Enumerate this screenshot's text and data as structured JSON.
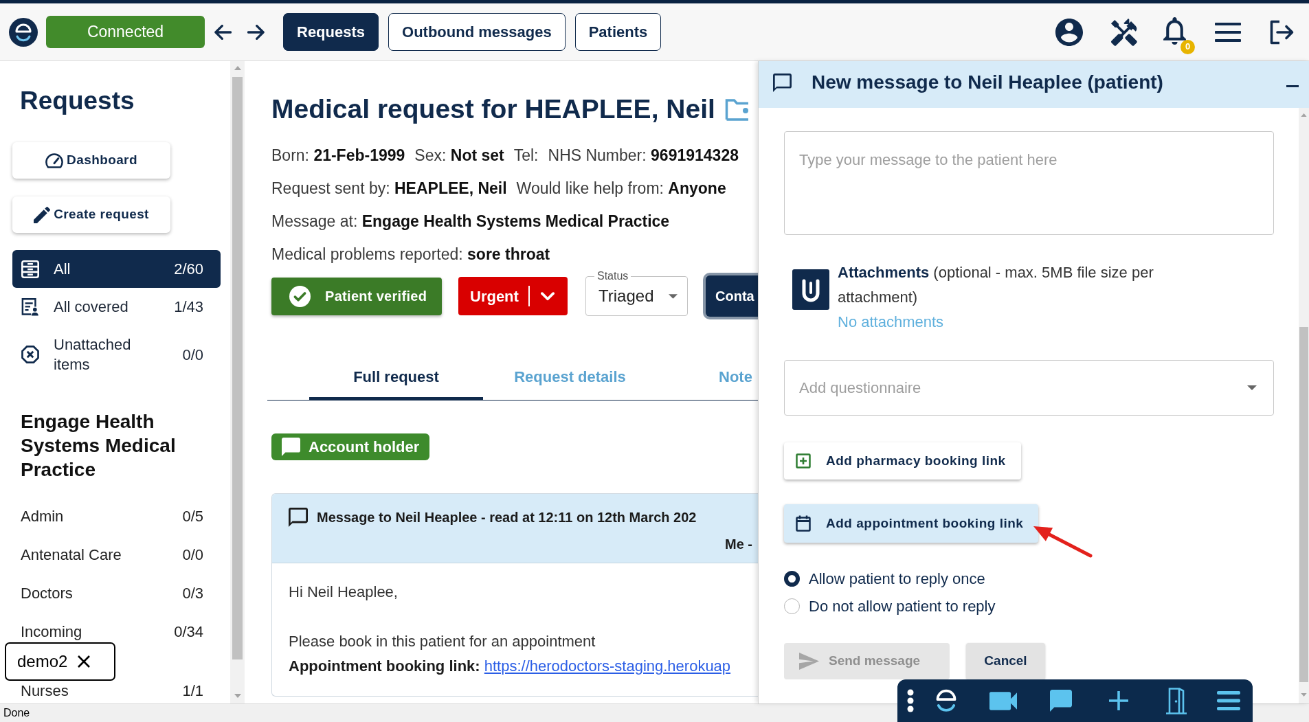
{
  "top_bar": {
    "connection": "Connected",
    "nav_tabs": [
      {
        "label": "Requests",
        "selected": true
      },
      {
        "label": "Outbound messages",
        "selected": false
      },
      {
        "label": "Patients",
        "selected": false
      }
    ],
    "notification_count": "0"
  },
  "sidebar": {
    "title": "Requests",
    "actions": [
      {
        "kind": "dashboard",
        "label": "Dashboard"
      },
      {
        "kind": "create",
        "label": "Create request"
      }
    ],
    "filters": [
      {
        "kind": "all",
        "label": "All",
        "count": "2/60",
        "selected": true
      },
      {
        "kind": "covered",
        "label": "All covered",
        "count": "1/43",
        "selected": false
      },
      {
        "kind": "unattached",
        "label": "Unattached items",
        "count": "0/0",
        "selected": false
      }
    ],
    "practice": "Engage Health Systems Medical Practice",
    "teams": [
      {
        "label": "Admin",
        "count": "0/5"
      },
      {
        "label": "Antenatal Care",
        "count": "0/0"
      },
      {
        "label": "Doctors",
        "count": "0/3"
      },
      {
        "label": "Incoming",
        "count": "0/34"
      },
      {
        "label": "Nurses",
        "count": "1/1"
      }
    ]
  },
  "request": {
    "title": "Medical request for HEAPLEE, Neil",
    "detail_lines": [
      {
        "fields": [
          "Born: **21-Feb-1999**",
          "Sex: **Not set**",
          "Tel:",
          "NHS Number: **9691914328**"
        ]
      },
      {
        "fields": [
          "Request sent by: **HEAPLEE, Neil**",
          "Would like help from: **Anyone**"
        ]
      },
      {
        "fields": [
          "Message at: **Engage Health Systems Medical Practice**"
        ]
      },
      {
        "fields": [
          "Medical problems reported: **sore throat**"
        ]
      }
    ],
    "verified": "Patient verified",
    "priority": "Urgent",
    "status": {
      "label": "Status",
      "value": "Triaged"
    },
    "contact": "Conta",
    "tabs": [
      {
        "label": "Full request",
        "selected": true
      },
      {
        "label": "Request details",
        "selected": false
      },
      {
        "label": "Note",
        "selected": false
      }
    ],
    "account_badge": "Account holder",
    "message": {
      "title": "Message to Neil Heaplee - read at 12:11 on 12th March 202",
      "sender": "Me -",
      "lines": [
        "Hi Neil Heaplee,",
        "Please book in this patient for an appointment"
      ],
      "link_label": "Appointment booking link:",
      "link": "https://herodoctors-staging.herokuap"
    }
  },
  "composer": {
    "title": "New message to Neil Heaplee (patient)",
    "message_placeholder": "Type your message to the patient here",
    "attachments": {
      "text": "**Attachments** (optional - max. 5MB file size per attachment)",
      "status": "No attachments"
    },
    "questionnaire_placeholder": "Add questionnaire",
    "link_buttons": [
      {
        "kind": "pharmacy",
        "label": "Add pharmacy booking link",
        "highlighted": false
      },
      {
        "kind": "appointment",
        "label": "Add appointment booking link",
        "highlighted": true
      }
    ],
    "reply_options": [
      {
        "label": "Allow patient to reply once",
        "selected": true
      },
      {
        "label": "Do not allow patient to reply",
        "selected": false
      }
    ],
    "send": {
      "label": "Send message",
      "disabled": true
    },
    "cancel": "Cancel"
  },
  "session_tag": "demo2",
  "status_bar": "Done"
}
